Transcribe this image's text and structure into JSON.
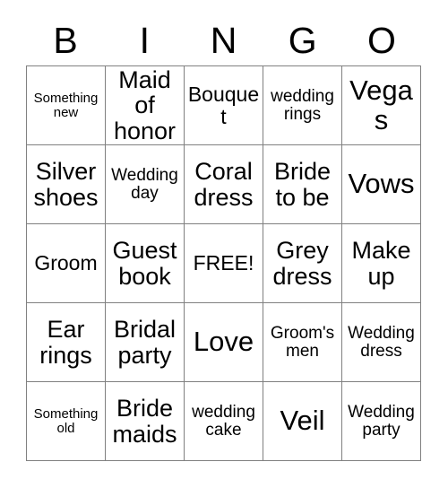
{
  "card": {
    "header_letters": [
      "B",
      "I",
      "N",
      "G",
      "O"
    ],
    "rows": [
      [
        {
          "text": "Something new",
          "size": "xs"
        },
        {
          "text": "Maid of honor",
          "size": "lg"
        },
        {
          "text": "Bouquet",
          "size": "md"
        },
        {
          "text": "wedding rings",
          "size": "sm"
        },
        {
          "text": "Vegas",
          "size": "xl"
        }
      ],
      [
        {
          "text": "Silver shoes",
          "size": "lg"
        },
        {
          "text": "Wedding day",
          "size": "sm"
        },
        {
          "text": "Coral dress",
          "size": "lg"
        },
        {
          "text": "Bride to be",
          "size": "lg"
        },
        {
          "text": "Vows",
          "size": "xl"
        }
      ],
      [
        {
          "text": "Groom",
          "size": "md"
        },
        {
          "text": "Guest book",
          "size": "lg"
        },
        {
          "text": "FREE!",
          "size": "md"
        },
        {
          "text": "Grey dress",
          "size": "lg"
        },
        {
          "text": "Make up",
          "size": "lg"
        }
      ],
      [
        {
          "text": "Ear rings",
          "size": "lg"
        },
        {
          "text": "Bridal party",
          "size": "lg"
        },
        {
          "text": "Love",
          "size": "xl"
        },
        {
          "text": "Groom's men",
          "size": "sm"
        },
        {
          "text": "Wedding dress",
          "size": "sm"
        }
      ],
      [
        {
          "text": "Something old",
          "size": "xs"
        },
        {
          "text": "Bride maids",
          "size": "lg"
        },
        {
          "text": "wedding cake",
          "size": "sm"
        },
        {
          "text": "Veil",
          "size": "xl"
        },
        {
          "text": "Wedding party",
          "size": "sm"
        }
      ]
    ]
  }
}
